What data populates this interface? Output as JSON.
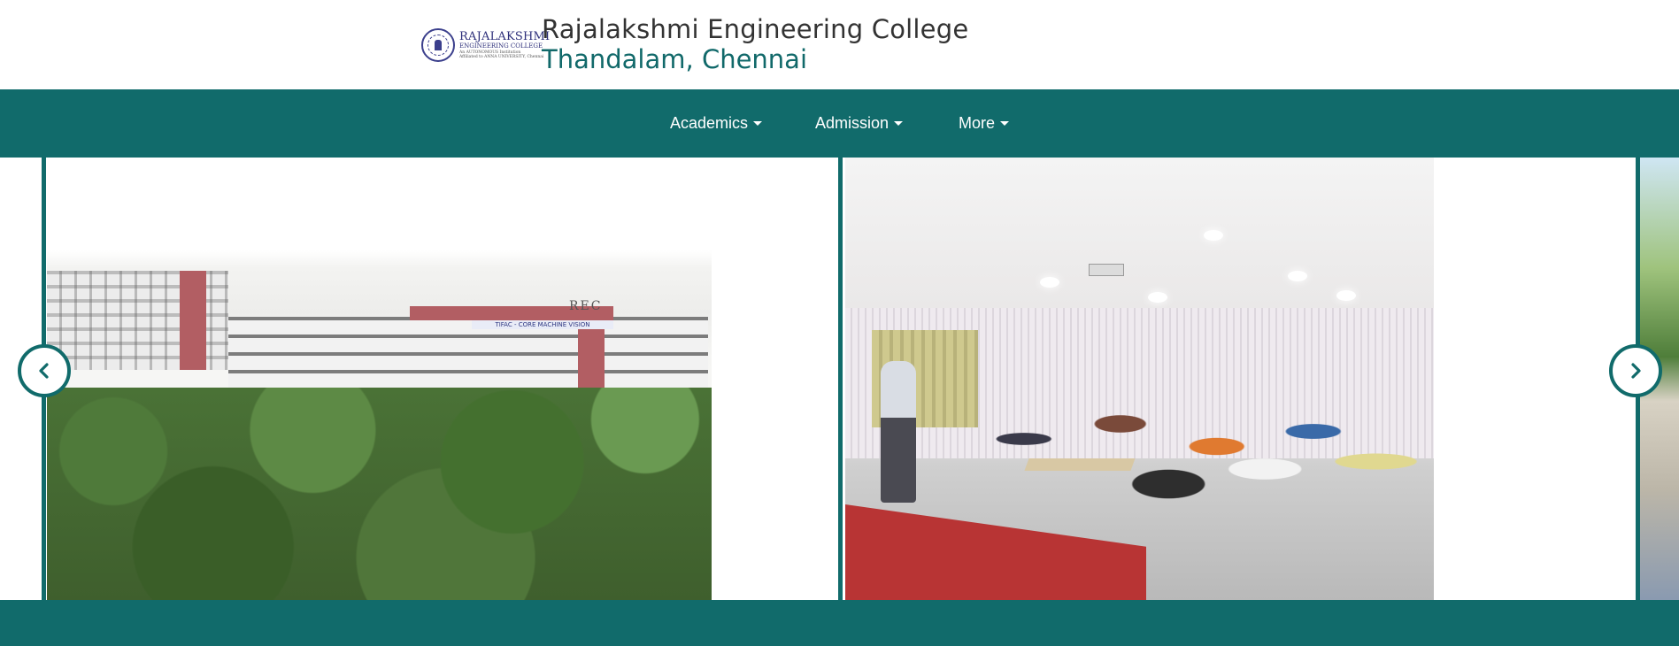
{
  "header": {
    "logo": {
      "line1": "RAJALAKSHMI",
      "line2": "ENGINEERING COLLEGE",
      "line3": "An AUTONOMOUS Institution",
      "line4": "Affiliated to ANNA UNIVERSITY, Chennai"
    },
    "college_name": "Rajalakshmi Engineering College",
    "college_place": "Thandalam, Chennai"
  },
  "nav": {
    "items": [
      {
        "label": "Academics"
      },
      {
        "label": "Admission"
      },
      {
        "label": "More"
      }
    ]
  },
  "carousel": {
    "slide1": {
      "sign": "TIFAC - CORE MACHINE VISION",
      "building_label": "REC"
    },
    "prev_icon": "chevron-left-icon",
    "next_icon": "chevron-right-icon"
  },
  "colors": {
    "brand": "#116b6b",
    "title_text": "#333333",
    "subtitle_text": "#11696a"
  }
}
